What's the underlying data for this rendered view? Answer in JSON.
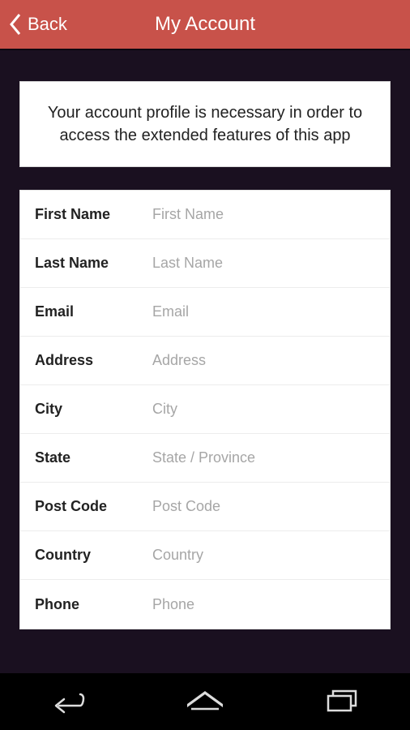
{
  "header": {
    "back_label": "Back",
    "title": "My Account"
  },
  "info_text": "Your account profile is necessary in order to access the extended features of this app",
  "fields": {
    "first_name": {
      "label": "First Name",
      "placeholder": "First Name",
      "value": ""
    },
    "last_name": {
      "label": "Last Name",
      "placeholder": "Last Name",
      "value": ""
    },
    "email": {
      "label": "Email",
      "placeholder": "Email",
      "value": ""
    },
    "address": {
      "label": "Address",
      "placeholder": "Address",
      "value": ""
    },
    "city": {
      "label": "City",
      "placeholder": "City",
      "value": ""
    },
    "state": {
      "label": "State",
      "placeholder": "State / Province",
      "value": ""
    },
    "post_code": {
      "label": "Post Code",
      "placeholder": "Post Code",
      "value": ""
    },
    "country": {
      "label": "Country",
      "placeholder": "Country",
      "value": ""
    },
    "phone": {
      "label": "Phone",
      "placeholder": "Phone",
      "value": ""
    }
  }
}
